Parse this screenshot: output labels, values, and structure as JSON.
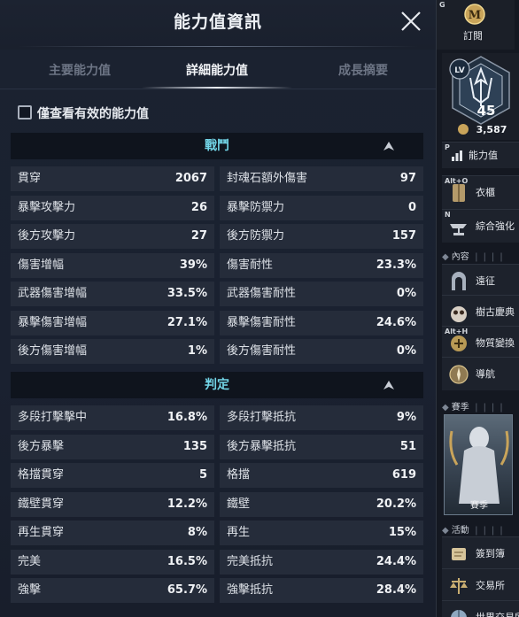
{
  "panel": {
    "title": "能力值資訊",
    "tabs": [
      {
        "label": "主要能力值",
        "active": false
      },
      {
        "label": "詳細能力值",
        "active": true
      },
      {
        "label": "成長摘要",
        "active": false
      }
    ],
    "filter_label": "僅查看有效的能力值",
    "filter_checked": false
  },
  "sections": [
    {
      "title": "戰鬥",
      "rows": [
        [
          {
            "label": "貫穿",
            "value": "2067"
          },
          {
            "label": "封魂石額外傷害",
            "value": "97"
          }
        ],
        [
          {
            "label": "暴擊攻擊力",
            "value": "26"
          },
          {
            "label": "暴擊防禦力",
            "value": "0"
          }
        ],
        [
          {
            "label": "後方攻擊力",
            "value": "27"
          },
          {
            "label": "後方防禦力",
            "value": "157"
          }
        ],
        [
          {
            "label": "傷害增幅",
            "value": "39%"
          },
          {
            "label": "傷害耐性",
            "value": "23.3%"
          }
        ],
        [
          {
            "label": "武器傷害增幅",
            "value": "33.5%"
          },
          {
            "label": "武器傷害耐性",
            "value": "0%"
          }
        ],
        [
          {
            "label": "暴擊傷害增幅",
            "value": "27.1%"
          },
          {
            "label": "暴擊傷害耐性",
            "value": "24.6%"
          }
        ],
        [
          {
            "label": "後方傷害增幅",
            "value": "1%"
          },
          {
            "label": "後方傷害耐性",
            "value": "0%"
          }
        ]
      ]
    },
    {
      "title": "判定",
      "rows": [
        [
          {
            "label": "多段打擊擊中",
            "value": "16.8%"
          },
          {
            "label": "多段打擊抵抗",
            "value": "9%"
          }
        ],
        [
          {
            "label": "後方暴擊",
            "value": "135"
          },
          {
            "label": "後方暴擊抵抗",
            "value": "51"
          }
        ],
        [
          {
            "label": "格擋貫穿",
            "value": "5"
          },
          {
            "label": "格擋",
            "value": "619"
          }
        ],
        [
          {
            "label": "鐵壁貫穿",
            "value": "12.2%"
          },
          {
            "label": "鐵壁",
            "value": "20.2%"
          }
        ],
        [
          {
            "label": "再生貫穿",
            "value": "8%"
          },
          {
            "label": "再生",
            "value": "15%"
          }
        ],
        [
          {
            "label": "完美",
            "value": "16.5%"
          },
          {
            "label": "完美抵抗",
            "value": "24.4%"
          }
        ],
        [
          {
            "label": "強擊",
            "value": "65.7%"
          },
          {
            "label": "強擊抵抗",
            "value": "28.4%"
          }
        ]
      ]
    }
  ],
  "sidebar": {
    "top": {
      "hotkey": "G",
      "label": "訂閱",
      "badge": "M"
    },
    "level": {
      "tag": "LV",
      "value": "45",
      "power": "3,587"
    },
    "stats_item": {
      "hotkey": "P",
      "label": "能力值",
      "icon": "bar-chart-icon"
    },
    "items1": [
      {
        "hotkey": "Alt+O",
        "label": "衣櫃",
        "icon": "wardrobe-icon"
      },
      {
        "hotkey": "N",
        "label": "綜合強化",
        "icon": "anvil-icon"
      }
    ],
    "section_content": "內容",
    "items2": [
      {
        "hotkey": "",
        "label": "遠征",
        "icon": "gate-icon"
      },
      {
        "hotkey": "",
        "label": "樹古慶典",
        "icon": "owl-icon"
      },
      {
        "hotkey": "Alt+H",
        "label": "物質變換",
        "icon": "transmute-icon"
      },
      {
        "hotkey": "",
        "label": "導航",
        "icon": "compass-icon"
      }
    ],
    "section_season": "賽季",
    "season_label": "賽季",
    "section_activity": "活動",
    "items3": [
      {
        "hotkey": "",
        "label": "簽到簿",
        "icon": "scroll-icon"
      },
      {
        "hotkey": "",
        "label": "交易所",
        "icon": "scale-icon"
      },
      {
        "hotkey": "",
        "label": "世界交易所",
        "icon": "globe-icon"
      }
    ]
  },
  "colors": {
    "section_title": "#73d6e8",
    "cell_bg": "#252c3a",
    "panel_bg": "#1b2230",
    "active_tab": "#f1f3f6",
    "inactive_tab": "#6d7585"
  }
}
